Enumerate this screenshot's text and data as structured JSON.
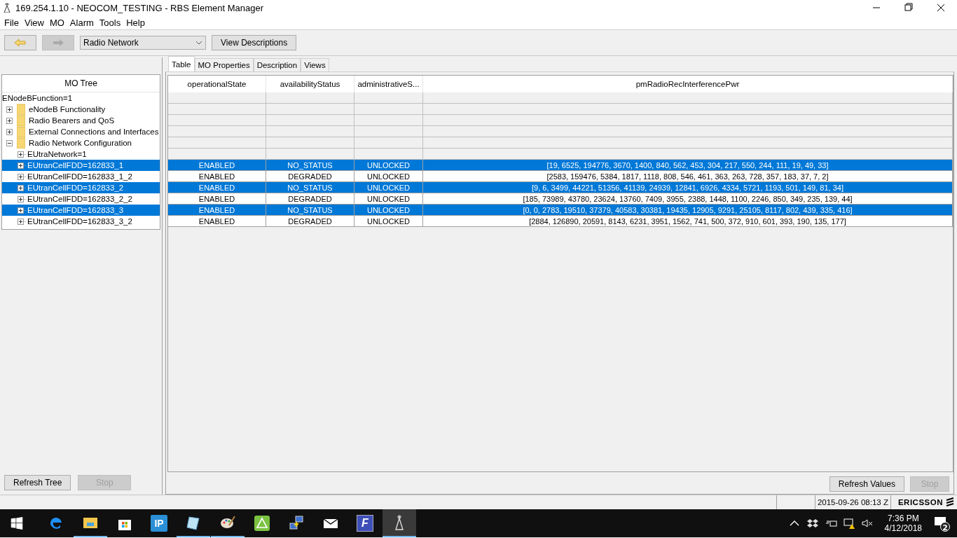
{
  "window": {
    "title": "169.254.1.10 - NEOCOM_TESTING - RBS Element Manager"
  },
  "menu": [
    "File",
    "View",
    "MO",
    "Alarm",
    "Tools",
    "Help"
  ],
  "toolbar": {
    "back_disabled": false,
    "forward_disabled": true,
    "dropdown_value": "Radio Network",
    "view_button": "View Descriptions"
  },
  "tree": {
    "header": "MO Tree",
    "root": {
      "label": "ENodeBFunction=1",
      "children": [
        {
          "label": "eNodeB Functionality",
          "kind": "folder",
          "expanded": false,
          "selected": false
        },
        {
          "label": "Radio Bearers and QoS",
          "kind": "folder",
          "expanded": false,
          "selected": false
        },
        {
          "label": "External Connections and Interfaces",
          "kind": "folder",
          "expanded": false,
          "selected": false
        },
        {
          "label": "Radio Network Configuration",
          "kind": "folder",
          "expanded": true,
          "selected": false,
          "children": [
            {
              "label": "EUtraNetwork=1",
              "kind": "mo",
              "expanded": false,
              "selected": false
            },
            {
              "label": "EUtranCellFDD=162833_1",
              "kind": "mo",
              "expanded": false,
              "selected": true
            },
            {
              "label": "EUtranCellFDD=162833_1_2",
              "kind": "mo",
              "expanded": false,
              "selected": false
            },
            {
              "label": "EUtranCellFDD=162833_2",
              "kind": "mo",
              "expanded": false,
              "selected": true
            },
            {
              "label": "EUtranCellFDD=162833_2_2",
              "kind": "mo",
              "expanded": false,
              "selected": false
            },
            {
              "label": "EUtranCellFDD=162833_3",
              "kind": "mo",
              "expanded": false,
              "selected": true
            },
            {
              "label": "EUtranCellFDD=162833_3_2",
              "kind": "mo",
              "expanded": false,
              "selected": false
            }
          ]
        }
      ]
    }
  },
  "tree_buttons": [
    {
      "label": "Refresh Tree",
      "disabled": false
    },
    {
      "label": "Stop",
      "disabled": true
    }
  ],
  "tabs": [
    {
      "label": "Table",
      "selected": true
    },
    {
      "label": "MO Properties",
      "selected": false
    },
    {
      "label": "Description",
      "selected": false
    },
    {
      "label": "Views",
      "selected": false
    }
  ],
  "table": {
    "columns": [
      "operationalState",
      "availabilityStatus",
      "administrativeS...",
      "pmRadioRecInterferencePwr"
    ],
    "rows": [
      {
        "kind": "blank"
      },
      {
        "kind": "blank"
      },
      {
        "kind": "blank"
      },
      {
        "kind": "blank"
      },
      {
        "kind": "blank"
      },
      {
        "kind": "blank"
      },
      {
        "kind": "data",
        "selected": true,
        "cells": [
          "ENABLED",
          "NO_STATUS",
          "UNLOCKED",
          "[19, 6525, 194776, 3670, 1400, 840, 562, 453, 304, 217, 550, 244, 111, 19, 49, 33]"
        ]
      },
      {
        "kind": "data",
        "selected": false,
        "cells": [
          "ENABLED",
          "DEGRADED",
          "UNLOCKED",
          "[2583, 159476, 5384, 1817, 1118, 808, 546, 461, 363, 263, 728, 357, 183, 37, 7, 2]"
        ]
      },
      {
        "kind": "data",
        "selected": true,
        "cells": [
          "ENABLED",
          "NO_STATUS",
          "UNLOCKED",
          "[9, 6, 3499, 44221, 51356, 41139, 24939, 12841, 6926, 4334, 5721, 1193, 501, 149, 81, 34]"
        ]
      },
      {
        "kind": "data",
        "selected": false,
        "cells": [
          "ENABLED",
          "DEGRADED",
          "UNLOCKED",
          "[185, 73989, 43780, 23624, 13760, 7409, 3955, 2388, 1448, 1100, 2246, 850, 349, 235, 139, 44]"
        ]
      },
      {
        "kind": "data",
        "selected": true,
        "cells": [
          "ENABLED",
          "NO_STATUS",
          "UNLOCKED",
          "[0, 0, 2783, 19510, 37379, 40583, 30381, 19435, 12905, 9291, 25105, 8117, 802, 439, 335, 416]"
        ]
      },
      {
        "kind": "data",
        "selected": false,
        "cells": [
          "ENABLED",
          "DEGRADED",
          "UNLOCKED",
          "[2884, 126890, 20591, 8143, 6231, 3951, 1562, 741, 500, 372, 910, 601, 393, 190, 135, 177]"
        ]
      }
    ]
  },
  "table_buttons": [
    {
      "label": "Refresh Values",
      "disabled": false
    },
    {
      "label": "Stop",
      "disabled": true
    }
  ],
  "status_bar": {
    "timestamp": "2015-09-26 08:13 Z",
    "logo": "ERICSSON"
  },
  "taskbar": {
    "apps": [
      {
        "kind": "edge",
        "running": false,
        "selected": false
      },
      {
        "kind": "explorer",
        "running": true,
        "selected": false
      },
      {
        "kind": "store",
        "running": false,
        "selected": false
      },
      {
        "kind": "ip",
        "running": false,
        "selected": false
      },
      {
        "kind": "notepad",
        "running": true,
        "selected": false
      },
      {
        "kind": "paint",
        "running": true,
        "selected": false
      },
      {
        "kind": "triangle",
        "running": false,
        "selected": false
      },
      {
        "kind": "network",
        "running": false,
        "selected": false
      },
      {
        "kind": "mail",
        "running": false,
        "selected": false
      },
      {
        "kind": "fapp",
        "running": false,
        "selected": false
      },
      {
        "kind": "tower",
        "running": true,
        "selected": true
      }
    ],
    "ip_label": "IP",
    "fapp_label": "F",
    "time": "7:36 PM",
    "date": "4/12/2018",
    "notifications": "2"
  }
}
